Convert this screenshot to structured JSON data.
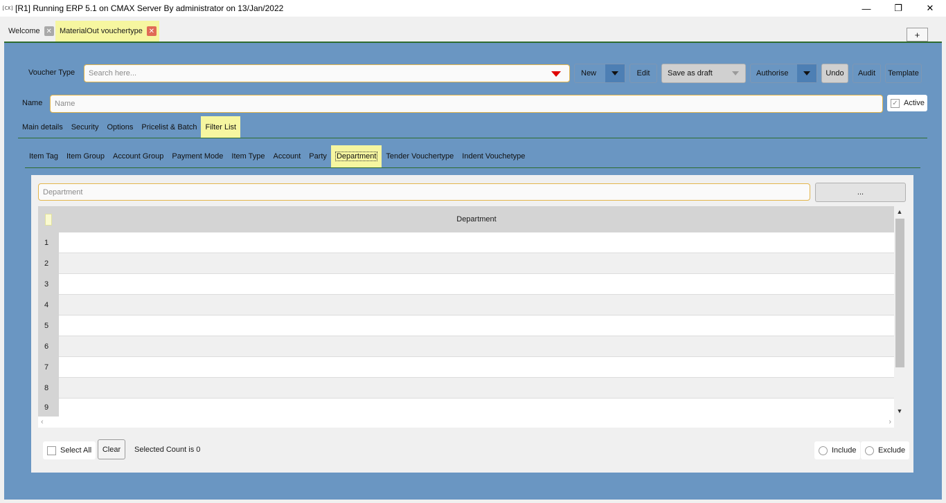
{
  "window": {
    "app_icon": "[CX]",
    "title": "[R1] Running ERP 5.1 on CMAX Server By administrator on 13/Jan/2022",
    "minimize": "—",
    "restore": "❐",
    "close": "✕"
  },
  "doc_tabs": [
    {
      "label": "Welcome",
      "close": "✕"
    },
    {
      "label": "MaterialOut vouchertype",
      "close": "✕"
    }
  ],
  "add_tab": "+",
  "toolbar": {
    "voucher_type_label": "Voucher Type",
    "search_placeholder": "Search here...",
    "new": "New",
    "edit": "Edit",
    "save_as_draft": "Save as draft",
    "authorise": "Authorise",
    "undo": "Undo",
    "audit": "Audit",
    "template": "Template"
  },
  "name_row": {
    "label": "Name",
    "placeholder": "Name",
    "active_label": "Active",
    "active_checked": true
  },
  "main_tabs": [
    "Main details",
    "Security",
    "Options",
    "Pricelist & Batch",
    "Filter List"
  ],
  "filter_tabs": [
    "Item Tag",
    "Item Group",
    "Account Group",
    "Payment Mode",
    "Item Type",
    "Account",
    "Party",
    "Department",
    "Tender Vouchertype",
    "Indent Vouchetype"
  ],
  "filter": {
    "input_placeholder": "Department",
    "browse_label": "...",
    "column_header": "Department",
    "rows": [
      "1",
      "2",
      "3",
      "4",
      "5",
      "6",
      "7",
      "8",
      "9"
    ]
  },
  "footer": {
    "select_all": "Select All",
    "clear": "Clear",
    "selected_count": "Selected Count is 0",
    "include": "Include",
    "exclude": "Exclude"
  },
  "colors": {
    "main_bg": "#6a96c2",
    "active_tab": "#f6f6a0",
    "accent_border": "#e3b54a",
    "divider": "#2e6b2e"
  }
}
